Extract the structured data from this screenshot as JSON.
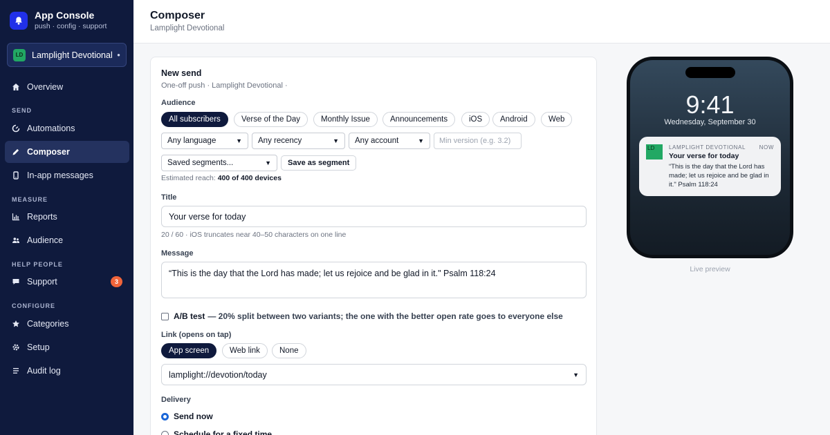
{
  "app": {
    "title": "App Console",
    "subtitle": "push · config · support"
  },
  "workspace": {
    "badge": "LD",
    "name": "Lamplight Devotional"
  },
  "nav": {
    "overview": "Overview",
    "section_send": "SEND",
    "automations": "Automations",
    "composer": "Composer",
    "inapp": "In-app messages",
    "section_measure": "MEASURE",
    "reports": "Reports",
    "audience": "Audience",
    "section_help": "HELP PEOPLE",
    "support": "Support",
    "support_badge": "3",
    "section_configure": "CONFIGURE",
    "categories": "Categories",
    "setup": "Setup",
    "audit": "Audit log"
  },
  "header": {
    "title": "Composer",
    "subtitle": "Lamplight Devotional"
  },
  "form": {
    "title": "New send",
    "subtitle": "One-off push · Lamplight Devotional ·",
    "audience_label": "Audience",
    "audience_chips": [
      "All subscribers",
      "Verse of the Day",
      "Monthly Issue",
      "Announcements",
      "iOS",
      "Android",
      "Web"
    ],
    "language": "Any language",
    "recency": "Any recency",
    "account": "Any account",
    "min_version_placeholder": "Min version (e.g. 3.2)",
    "saved_segments": "Saved segments...",
    "save_segment": "Save as segment",
    "reach_label": "Estimated reach:",
    "reach_value": "400 of 400 devices",
    "title_label": "Title",
    "title_value": "Your verse for today",
    "title_hint": "20 / 60 · iOS truncates near 40–50 characters on one line",
    "message_label": "Message",
    "message_value": "“This is the day that the Lord has made; let us rejoice and be glad in it.\" Psalm 118:24",
    "ab_label": "A/B test",
    "ab_desc": "— 20% split between two variants; the one with the better open rate goes to everyone else",
    "link_label": "Link (opens on tap)",
    "link_chips": [
      "App screen",
      "Web link",
      "None"
    ],
    "link_value": "lamplight://devotion/today",
    "delivery_label": "Delivery",
    "delivery_now": "Send now",
    "delivery_fixed": "Schedule for a fixed time"
  },
  "preview": {
    "time": "9:41",
    "date": "Wednesday, September 30",
    "app_icon": "LD",
    "app_name": "LAMPLIGHT DEVOTIONAL",
    "when": "NOW",
    "title": "Your verse for today",
    "body": "“This is the day that the Lord has made; let us rejoice and be glad in it.\" Psalm 118:24",
    "caption": "Live preview"
  },
  "colors": {
    "sidebar": "#0f1a3d",
    "accent": "#2130e8",
    "badge": "#f0643a",
    "app_green": "#22a864"
  }
}
